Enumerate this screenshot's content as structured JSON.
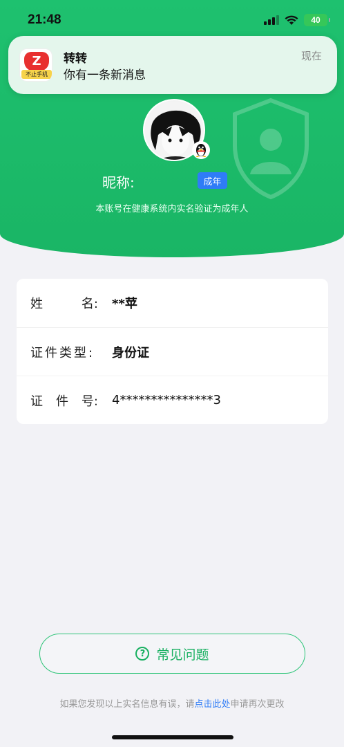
{
  "status_bar": {
    "time": "21:48",
    "battery": "40"
  },
  "notification": {
    "app_name": "转转",
    "message": "你有一条新消息",
    "time": "现在",
    "icon_label": "Z",
    "icon_tag": "不止手机"
  },
  "profile": {
    "nickname_label": "昵称:",
    "badge": "成年",
    "verify_text": "本账号在健康系统内实名验证为成年人"
  },
  "info": {
    "rows": [
      {
        "label_a": "姓",
        "label_b": "名:",
        "value": "**苹"
      },
      {
        "label_a": "证件类型:",
        "label_b": "",
        "value": "身份证"
      },
      {
        "label_a": "证",
        "label_mid": "件",
        "label_b": "号:",
        "value": "4***************3"
      }
    ]
  },
  "faq": {
    "label": "常见问题",
    "icon": "?"
  },
  "footer": {
    "text_before": "如果您发现以上实名信息有误，请",
    "link": "点击此处",
    "text_after": "申请再次更改"
  },
  "colors": {
    "brand_green": "#1ec16f",
    "badge_blue": "#2f7cf6"
  }
}
